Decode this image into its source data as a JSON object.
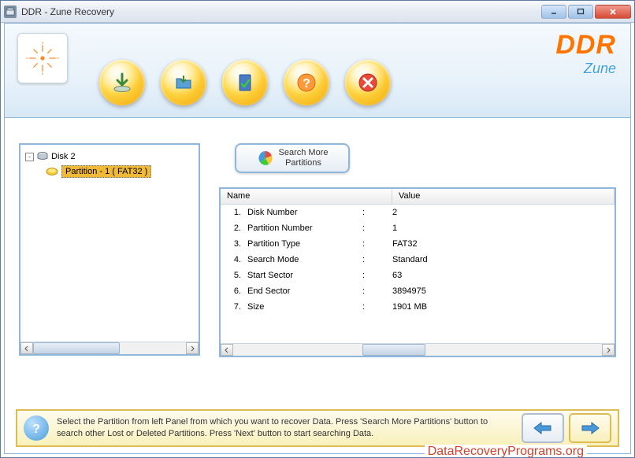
{
  "window": {
    "title": "DDR - Zune Recovery"
  },
  "brand": {
    "main": "DDR",
    "sub": "Zune"
  },
  "tree": {
    "disk_label": "Disk 2",
    "partition_label": "Partition - 1 ( FAT32 )",
    "expander": "-"
  },
  "search_button": {
    "line1": "Search More",
    "line2": "Partitions"
  },
  "table": {
    "header_name": "Name",
    "header_value": "Value",
    "rows": [
      {
        "num": "1.",
        "name": "Disk Number",
        "value": "2"
      },
      {
        "num": "2.",
        "name": "Partition Number",
        "value": "1"
      },
      {
        "num": "3.",
        "name": "Partition Type",
        "value": "FAT32"
      },
      {
        "num": "4.",
        "name": "Search Mode",
        "value": "Standard"
      },
      {
        "num": "5.",
        "name": "Start Sector",
        "value": "63"
      },
      {
        "num": "6.",
        "name": "End Sector",
        "value": "3894975"
      },
      {
        "num": "7.",
        "name": "Size",
        "value": "1901 MB"
      }
    ]
  },
  "footer": {
    "text": "Select the Partition from left Panel from which you want to recover Data. Press 'Search More Partitions' button to search other Lost or Deleted Partitions. Press 'Next' button to start searching Data."
  },
  "watermark": "DataRecoveryPrograms.org"
}
